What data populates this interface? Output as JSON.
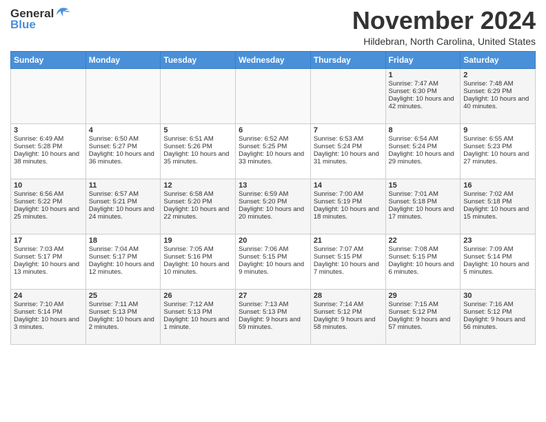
{
  "header": {
    "logo_general": "General",
    "logo_blue": "Blue",
    "month_title": "November 2024",
    "subtitle": "Hildebran, North Carolina, United States"
  },
  "weekdays": [
    "Sunday",
    "Monday",
    "Tuesday",
    "Wednesday",
    "Thursday",
    "Friday",
    "Saturday"
  ],
  "weeks": [
    [
      {
        "day": "",
        "content": ""
      },
      {
        "day": "",
        "content": ""
      },
      {
        "day": "",
        "content": ""
      },
      {
        "day": "",
        "content": ""
      },
      {
        "day": "",
        "content": ""
      },
      {
        "day": "1",
        "content": "Sunrise: 7:47 AM\nSunset: 6:30 PM\nDaylight: 10 hours and 42 minutes."
      },
      {
        "day": "2",
        "content": "Sunrise: 7:48 AM\nSunset: 6:29 PM\nDaylight: 10 hours and 40 minutes."
      }
    ],
    [
      {
        "day": "3",
        "content": "Sunrise: 6:49 AM\nSunset: 5:28 PM\nDaylight: 10 hours and 38 minutes."
      },
      {
        "day": "4",
        "content": "Sunrise: 6:50 AM\nSunset: 5:27 PM\nDaylight: 10 hours and 36 minutes."
      },
      {
        "day": "5",
        "content": "Sunrise: 6:51 AM\nSunset: 5:26 PM\nDaylight: 10 hours and 35 minutes."
      },
      {
        "day": "6",
        "content": "Sunrise: 6:52 AM\nSunset: 5:25 PM\nDaylight: 10 hours and 33 minutes."
      },
      {
        "day": "7",
        "content": "Sunrise: 6:53 AM\nSunset: 5:24 PM\nDaylight: 10 hours and 31 minutes."
      },
      {
        "day": "8",
        "content": "Sunrise: 6:54 AM\nSunset: 5:24 PM\nDaylight: 10 hours and 29 minutes."
      },
      {
        "day": "9",
        "content": "Sunrise: 6:55 AM\nSunset: 5:23 PM\nDaylight: 10 hours and 27 minutes."
      }
    ],
    [
      {
        "day": "10",
        "content": "Sunrise: 6:56 AM\nSunset: 5:22 PM\nDaylight: 10 hours and 25 minutes."
      },
      {
        "day": "11",
        "content": "Sunrise: 6:57 AM\nSunset: 5:21 PM\nDaylight: 10 hours and 24 minutes."
      },
      {
        "day": "12",
        "content": "Sunrise: 6:58 AM\nSunset: 5:20 PM\nDaylight: 10 hours and 22 minutes."
      },
      {
        "day": "13",
        "content": "Sunrise: 6:59 AM\nSunset: 5:20 PM\nDaylight: 10 hours and 20 minutes."
      },
      {
        "day": "14",
        "content": "Sunrise: 7:00 AM\nSunset: 5:19 PM\nDaylight: 10 hours and 18 minutes."
      },
      {
        "day": "15",
        "content": "Sunrise: 7:01 AM\nSunset: 5:18 PM\nDaylight: 10 hours and 17 minutes."
      },
      {
        "day": "16",
        "content": "Sunrise: 7:02 AM\nSunset: 5:18 PM\nDaylight: 10 hours and 15 minutes."
      }
    ],
    [
      {
        "day": "17",
        "content": "Sunrise: 7:03 AM\nSunset: 5:17 PM\nDaylight: 10 hours and 13 minutes."
      },
      {
        "day": "18",
        "content": "Sunrise: 7:04 AM\nSunset: 5:17 PM\nDaylight: 10 hours and 12 minutes."
      },
      {
        "day": "19",
        "content": "Sunrise: 7:05 AM\nSunset: 5:16 PM\nDaylight: 10 hours and 10 minutes."
      },
      {
        "day": "20",
        "content": "Sunrise: 7:06 AM\nSunset: 5:15 PM\nDaylight: 10 hours and 9 minutes."
      },
      {
        "day": "21",
        "content": "Sunrise: 7:07 AM\nSunset: 5:15 PM\nDaylight: 10 hours and 7 minutes."
      },
      {
        "day": "22",
        "content": "Sunrise: 7:08 AM\nSunset: 5:15 PM\nDaylight: 10 hours and 6 minutes."
      },
      {
        "day": "23",
        "content": "Sunrise: 7:09 AM\nSunset: 5:14 PM\nDaylight: 10 hours and 5 minutes."
      }
    ],
    [
      {
        "day": "24",
        "content": "Sunrise: 7:10 AM\nSunset: 5:14 PM\nDaylight: 10 hours and 3 minutes."
      },
      {
        "day": "25",
        "content": "Sunrise: 7:11 AM\nSunset: 5:13 PM\nDaylight: 10 hours and 2 minutes."
      },
      {
        "day": "26",
        "content": "Sunrise: 7:12 AM\nSunset: 5:13 PM\nDaylight: 10 hours and 1 minute."
      },
      {
        "day": "27",
        "content": "Sunrise: 7:13 AM\nSunset: 5:13 PM\nDaylight: 9 hours and 59 minutes."
      },
      {
        "day": "28",
        "content": "Sunrise: 7:14 AM\nSunset: 5:12 PM\nDaylight: 9 hours and 58 minutes."
      },
      {
        "day": "29",
        "content": "Sunrise: 7:15 AM\nSunset: 5:12 PM\nDaylight: 9 hours and 57 minutes."
      },
      {
        "day": "30",
        "content": "Sunrise: 7:16 AM\nSunset: 5:12 PM\nDaylight: 9 hours and 56 minutes."
      }
    ]
  ]
}
